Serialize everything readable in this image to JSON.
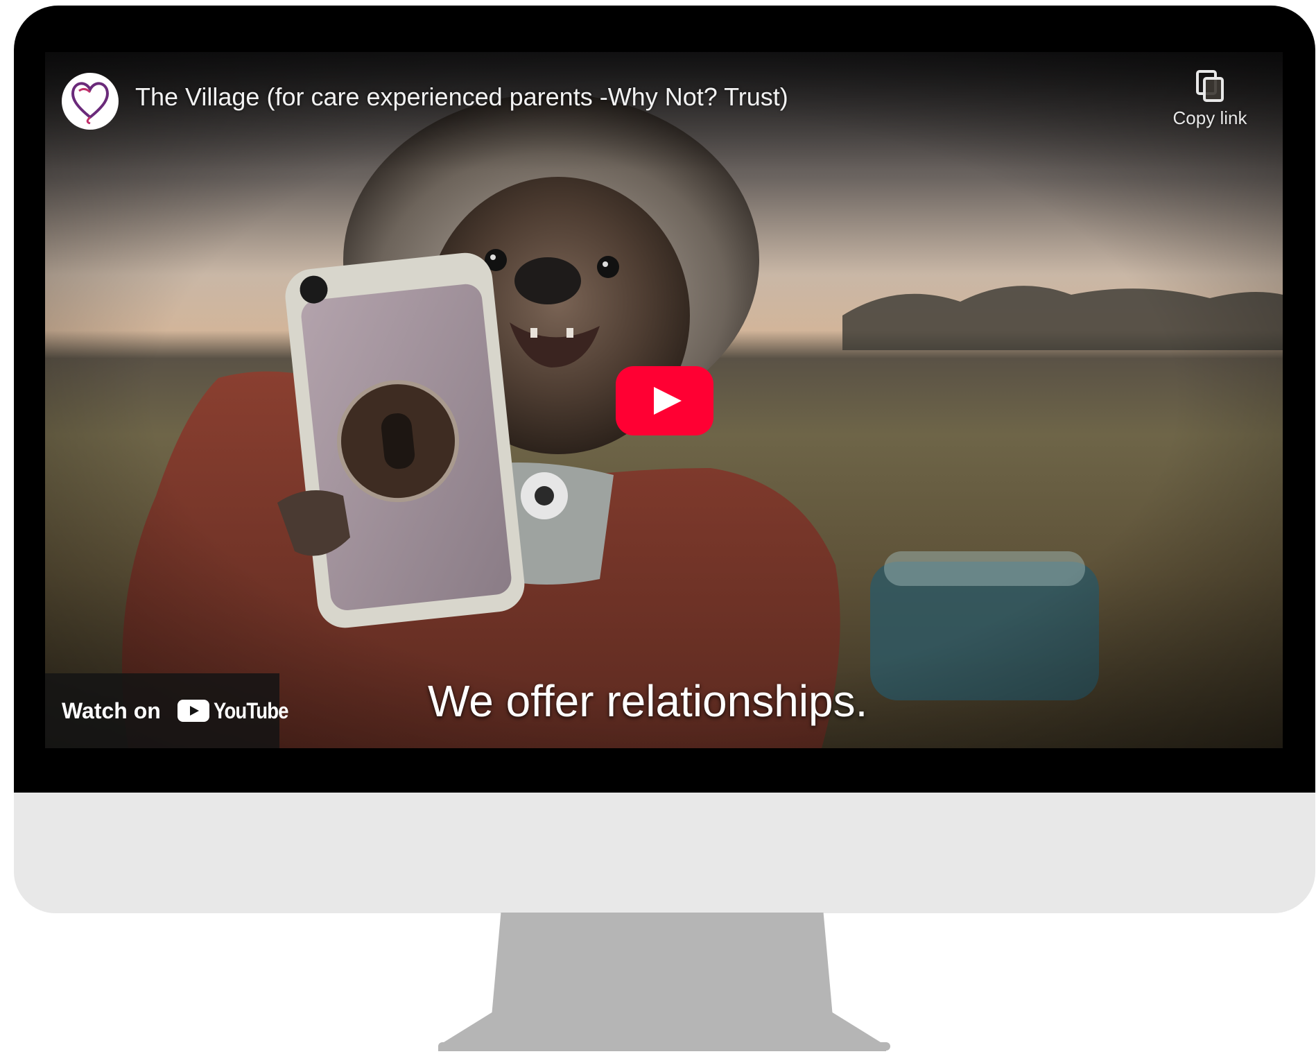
{
  "video": {
    "title": "The Village (for care experienced parents -Why Not? Trust)",
    "copy_link_label": "Copy link",
    "watch_on_label": "Watch on",
    "youtube_wordmark": "YouTube",
    "caption": "We offer relationships."
  },
  "icons": {
    "channel_avatar": "heart-logo-icon",
    "copy_link": "copy-icon",
    "play": "play-icon",
    "youtube": "youtube-logo-icon"
  },
  "colors": {
    "play_button": "#ff0033",
    "bezel": "#000000",
    "chin": "#e8e8e8",
    "stand": "#b5b5b5",
    "avatar_heart": "#6a2a7a"
  }
}
